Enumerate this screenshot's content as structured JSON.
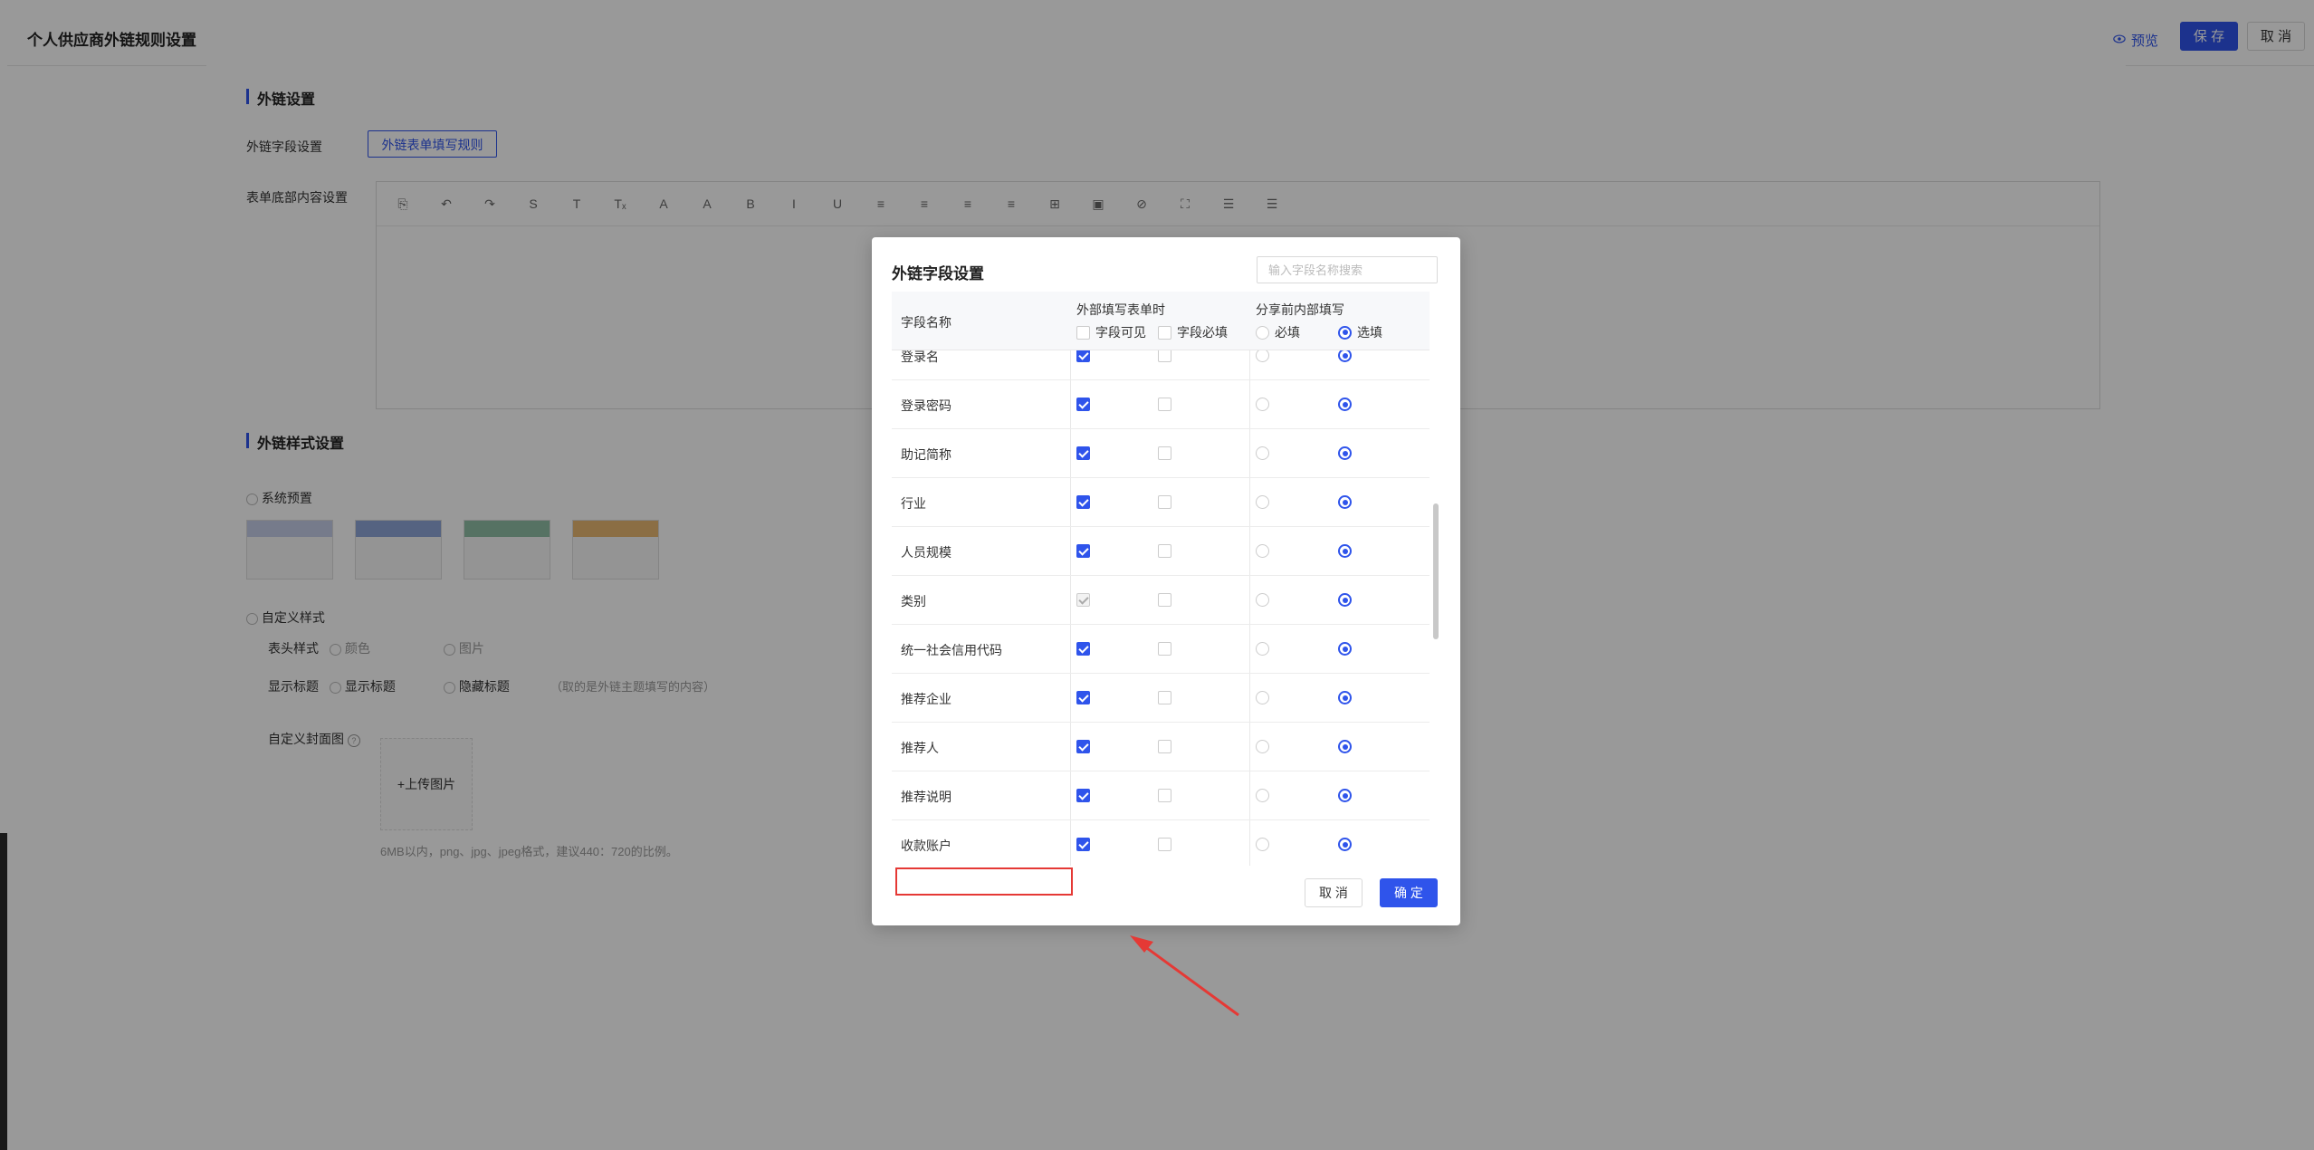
{
  "header": {
    "title": "个人供应商外链规则设置",
    "preview_label": "预览",
    "save_label": "保 存",
    "cancel_label": "取 消"
  },
  "external_link_settings": {
    "section_title": "外链设置",
    "field_settings_label": "外链字段设置",
    "field_rules_button": "外链表单填写规则",
    "form_bottom_label": "表单底部内容设置",
    "editor_toolbar": [
      "⎘",
      "↶",
      "↷",
      "S",
      "T",
      "Tₓ",
      "A",
      "A",
      "B",
      "I",
      "U",
      "≡",
      "≡",
      "≡",
      "≡",
      "⊞",
      "▣",
      "⊘",
      "⛶",
      "☰",
      "☰"
    ]
  },
  "style_settings": {
    "section_title": "外链样式设置",
    "system_preset_label": "系统预置",
    "custom_style_label": "自定义样式",
    "header_style_label": "表头样式",
    "header_style_options": [
      "颜色",
      "图片"
    ],
    "display_title_label": "显示标题",
    "display_title_options": [
      "显示标题",
      "隐藏标题"
    ],
    "display_title_hint": "（取的是外链主题填写的内容）",
    "cover_label": "自定义封面图",
    "upload_label": "+上传图片",
    "upload_hint": "6MB以内，png、jpg、jpeg格式，建议440：720的比例。"
  },
  "modal": {
    "title": "外链字段设置",
    "search_placeholder": "输入字段名称搜索",
    "columns": {
      "name": "字段名称",
      "external_group": "外部填写表单时",
      "visible": "字段可见",
      "required": "字段必填",
      "internal_group": "分享前内部填写",
      "must_fill": "必填",
      "optional": "选填"
    },
    "rows": [
      {
        "name": "登录名",
        "visible": "checked",
        "required": false,
        "fill": "optional"
      },
      {
        "name": "登录密码",
        "visible": "checked",
        "required": false,
        "fill": "optional"
      },
      {
        "name": "助记简称",
        "visible": "checked",
        "required": false,
        "fill": "optional"
      },
      {
        "name": "行业",
        "visible": "checked",
        "required": false,
        "fill": "optional"
      },
      {
        "name": "人员规模",
        "visible": "checked",
        "required": false,
        "fill": "optional"
      },
      {
        "name": "类别",
        "visible": "disabled",
        "required": false,
        "fill": "optional"
      },
      {
        "name": "统一社会信用代码",
        "visible": "checked",
        "required": false,
        "fill": "optional"
      },
      {
        "name": "推荐企业",
        "visible": "checked",
        "required": false,
        "fill": "optional"
      },
      {
        "name": "推荐人",
        "visible": "checked",
        "required": false,
        "fill": "optional"
      },
      {
        "name": "推荐说明",
        "visible": "checked",
        "required": false,
        "fill": "optional"
      },
      {
        "name": "收款账户",
        "visible": "checked",
        "required": false,
        "fill": "optional"
      }
    ],
    "cancel_label": "取 消",
    "confirm_label": "确 定"
  },
  "colors": {
    "accent": "#2f54eb",
    "annotation": "#e53935"
  }
}
